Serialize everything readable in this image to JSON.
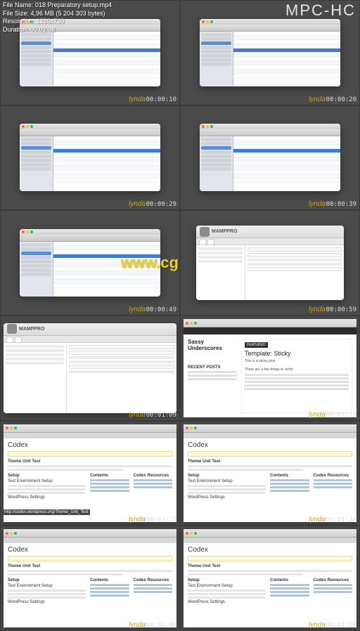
{
  "player": {
    "name": "MPC-HC",
    "info": {
      "filename_label": "File Name:",
      "filename": "018 Preparatory setup.mp4",
      "filesize_label": "File Size:",
      "filesize": "4,96 MB (5 204 303 bytes)",
      "resolution_label": "Resolution:",
      "resolution": "1280x720",
      "duration_label": "Duration:",
      "duration": "00:02:08"
    }
  },
  "watermark": "www.cg-ku.com",
  "brand": "lynda",
  "timestamps": [
    "00:00:10",
    "00:00:20",
    "00:00:29",
    "00:00:39",
    "00:00:49",
    "00:00:59",
    "00:01:09",
    "00:01:19",
    "00:01:29",
    "00:01:38",
    "00:01:48",
    "00:01:58"
  ],
  "mamp": {
    "title": "MAMPPRO"
  },
  "blog": {
    "site": "Sassy Underscores",
    "badge": "FEATURED",
    "post_title": "Template: Sticky",
    "intro": "This is a sticky post.",
    "sub": "There are a few things to verify:",
    "side_h": "RECENT POSTS"
  },
  "codex": {
    "title": "Codex",
    "sections": [
      "Theme Unit Test",
      "Setup",
      "Test Environment Setup",
      "WordPress Settings"
    ],
    "col_a": "Contents",
    "col_b": "Codex Resources",
    "tooltip": "http://codex.wordpress.org/Theme_Unit_Test"
  }
}
